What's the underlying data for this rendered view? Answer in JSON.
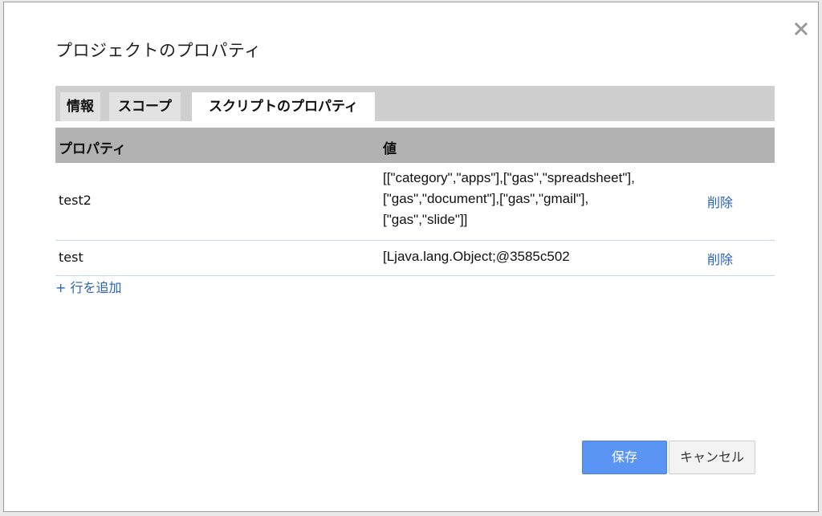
{
  "dialog": {
    "title": "プロジェクトのプロパティ",
    "close_icon": "close-icon"
  },
  "tabs": [
    {
      "label": "情報",
      "active": false
    },
    {
      "label": "スコープ",
      "active": false
    },
    {
      "label": "スクリプトのプロパティ",
      "active": true
    }
  ],
  "table": {
    "headers": {
      "property": "プロパティ",
      "value": "値"
    },
    "rows": [
      {
        "key": "test2",
        "value_lines": [
          "[[\"category\",\"apps\"],[\"gas\",\"spreadsheet\"],",
          "[\"gas\",\"document\"],[\"gas\",\"gmail\"],",
          "[\"gas\",\"slide\"]]"
        ],
        "delete_label": "削除"
      },
      {
        "key": "test",
        "value_lines": [
          "[Ljava.lang.Object;@3585c502"
        ],
        "delete_label": "削除"
      }
    ],
    "add_row_label": "+ 行を追加"
  },
  "buttons": {
    "save_label": "保存",
    "cancel_label": "キャンセル"
  },
  "colors": {
    "primary_button": "#5b95f4",
    "link": "#2a62b8",
    "header_bg": "#b2b2b2",
    "tabbar_bg": "#cfcfcf"
  }
}
